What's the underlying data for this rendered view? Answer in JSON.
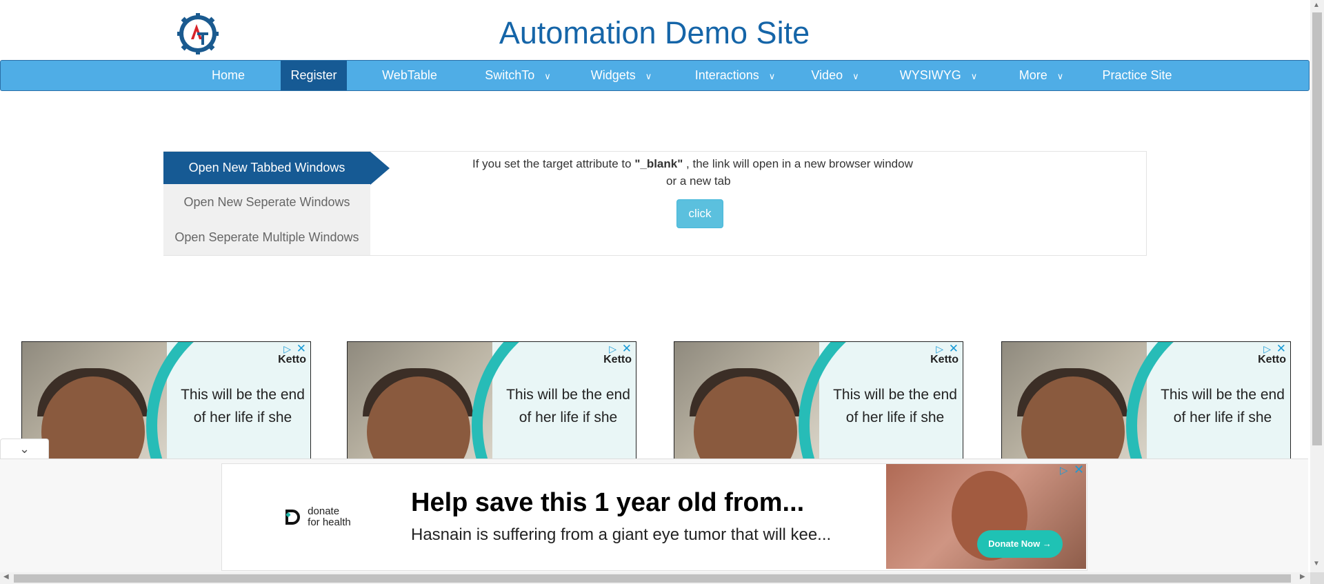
{
  "header": {
    "title": "Automation Demo Site"
  },
  "nav": {
    "items": [
      {
        "label": "Home"
      },
      {
        "label": "Register"
      },
      {
        "label": "WebTable"
      },
      {
        "label": "SwitchTo"
      },
      {
        "label": "Widgets"
      },
      {
        "label": "Interactions"
      },
      {
        "label": "Video"
      },
      {
        "label": "WYSIWYG"
      },
      {
        "label": "More"
      },
      {
        "label": "Practice Site"
      }
    ],
    "active": "Register",
    "colors": {
      "bar": "#4fade6",
      "active": "#165a94"
    }
  },
  "tabs": {
    "items": [
      {
        "label": "Open New Tabbed Windows"
      },
      {
        "label": "Open New Seperate Windows"
      },
      {
        "label": "Open Seperate Multiple Windows"
      }
    ],
    "active": "Open New Tabbed Windows",
    "content": {
      "text_before": "If you set the target attribute to ",
      "keyword": "\"_blank\"",
      "text_after": " , the link will open in a new browser window",
      "line2": "or a new tab",
      "button": "click"
    }
  },
  "ads": {
    "brand": "Ketto",
    "text": "This will be the end of her life if she",
    "count_label": "4"
  },
  "banner": {
    "logo_line1": "donate",
    "logo_line2": "for health",
    "headline": "Help save this 1 year old from...",
    "subtext": "Hasnain is suffering from a giant eye tumor that will kee...",
    "cta": "Donate Now →"
  }
}
